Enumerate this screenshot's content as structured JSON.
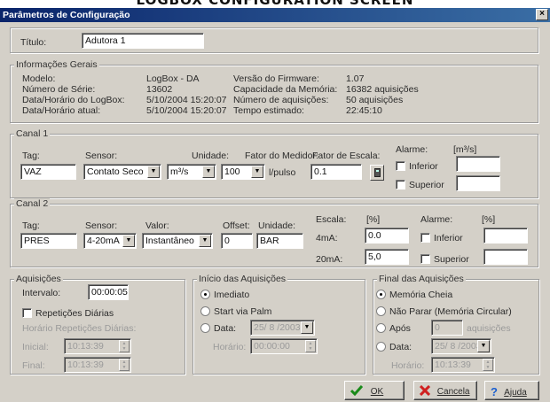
{
  "caption": "LOGBOX CONFIGURATION SCREEN",
  "window": {
    "title": "Parâmetros de Configuração",
    "close": "×"
  },
  "titulo": {
    "label": "Título:",
    "value": "Adutora 1"
  },
  "info": {
    "legend": "Informações Gerais",
    "modelo_label": "Modelo:",
    "modelo": "LogBox - DA",
    "serie_label": "Número de Série:",
    "serie": "13602",
    "datahora_logbox_label": "Data/Horário do LogBox:",
    "datahora_logbox": "5/10/2004 15:20:07",
    "datahora_atual_label": "Data/Horário atual:",
    "datahora_atual": "5/10/2004 15:20:07",
    "firmware_label": "Versão do Firmware:",
    "firmware": "1.07",
    "capacidade_label": "Capacidade da Memória:",
    "capacidade": "16382 aquisições",
    "num_aquisicoes_label": "Número de aquisições:",
    "num_aquisicoes": "50 aquisições",
    "tempo_label": "Tempo estimado:",
    "tempo": "22:45:10"
  },
  "canal1": {
    "legend": "Canal 1",
    "tag_label": "Tag:",
    "tag": "VAZ",
    "sensor_label": "Sensor:",
    "sensor": "Contato Seco",
    "unidade_label": "Unidade:",
    "unidade": "m³/s",
    "fator_medidor_label": "Fator do Medidor:",
    "fator_medidor": "100",
    "fator_medidor_unit": "l/pulso",
    "fator_escala_label": "Fator de Escala:",
    "fator_escala": "0.1",
    "alarme_label": "Alarme:",
    "alarme_unit": "[m³/s]",
    "inferior_label": "Inferior",
    "superior_label": "Superior"
  },
  "canal2": {
    "legend": "Canal 2",
    "tag_label": "Tag:",
    "tag": "PRES",
    "sensor_label": "Sensor:",
    "sensor": "4-20mA",
    "valor_label": "Valor:",
    "valor": "Instantâneo",
    "offset_label": "Offset:",
    "offset": "0",
    "unidade_label": "Unidade:",
    "unidade": "BAR",
    "escala_label": "Escala:",
    "escala_unit": "[%]",
    "ma4_label": "4mA:",
    "ma4": "0.0",
    "ma20_label": "20mA:",
    "ma20": "5,0",
    "alarme_label": "Alarme:",
    "alarme_unit": "[%]",
    "inferior_label": "Inferior",
    "superior_label": "Superior"
  },
  "aquisicoes": {
    "legend": "Aquisições",
    "intervalo_label": "Intervalo:",
    "intervalo": "00:00:05",
    "repeticoes_label": "Repetições Diárias",
    "horario_rep_label": "Horário Repetições Diárias:",
    "inicial_label": "Inicial:",
    "inicial": "10:13:39",
    "final_label": "Final:",
    "final": "10:13:39"
  },
  "inicio": {
    "legend": "Início das Aquisições",
    "imediato": "Imediato",
    "start_palm": "Start via Palm",
    "data_label": "Data:",
    "data": "25/ 8 /2003",
    "horario_label": "Horário:",
    "horario": "00:00:00"
  },
  "final_aq": {
    "legend": "Final das Aquisições",
    "memoria_cheia": "Memória Cheia",
    "nao_parar": "Não Parar (Memória Circular)",
    "apos_label": "Após",
    "apos_value": "0",
    "apos_unit": "aquisições",
    "data_label": "Data:",
    "data": "25/ 8 /2003",
    "horario_label": "Horário:",
    "horario": "10:13:39"
  },
  "buttons": {
    "ok": "OK",
    "cancelar": "Cancela",
    "ajuda": "Ajuda"
  }
}
